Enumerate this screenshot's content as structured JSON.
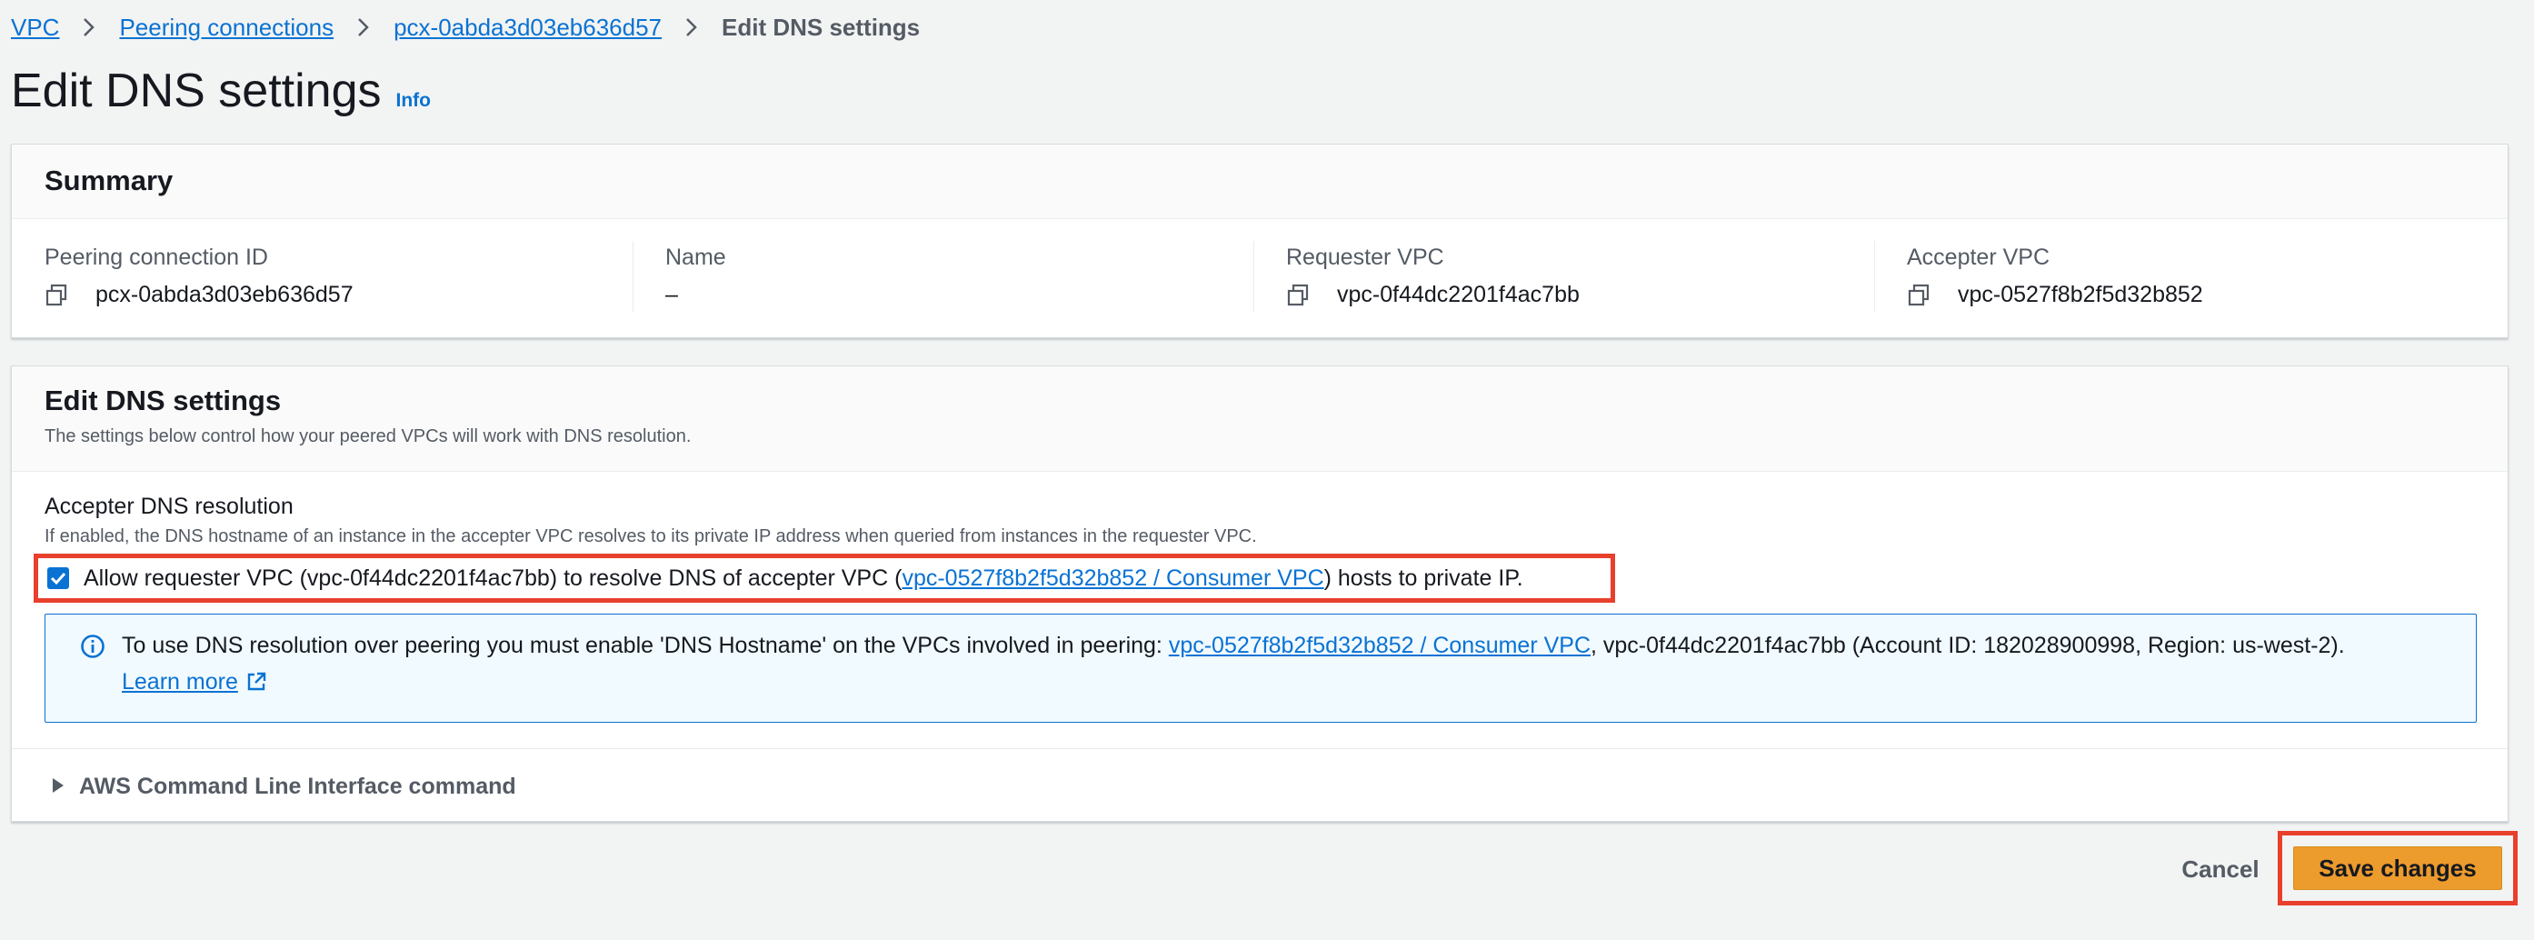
{
  "breadcrumb": {
    "items": [
      "VPC",
      "Peering connections",
      "pcx-0abda3d03eb636d57"
    ],
    "current": "Edit DNS settings"
  },
  "page": {
    "title": "Edit DNS settings",
    "info_label": "Info"
  },
  "summary": {
    "title": "Summary",
    "fields": [
      {
        "label": "Peering connection ID",
        "value": "pcx-0abda3d03eb636d57"
      },
      {
        "label": "Name",
        "value": "–"
      },
      {
        "label": "Requester VPC",
        "value": "vpc-0f44dc2201f4ac7bb"
      },
      {
        "label": "Accepter VPC",
        "value": "vpc-0527f8b2f5d32b852"
      }
    ]
  },
  "dns": {
    "title": "Edit DNS settings",
    "description": "The settings below control how your peered VPCs will work with DNS resolution.",
    "field_label": "Accepter DNS resolution",
    "field_description": "If enabled, the DNS hostname of an instance in the accepter VPC resolves to its private IP address when queried from instances in the requester VPC.",
    "checkbox_checked": true,
    "checkbox_prefix": "Allow requester VPC (vpc-0f44dc2201f4ac7bb) to resolve DNS of accepter VPC (",
    "checkbox_link": "vpc-0527f8b2f5d32b852 / Consumer VPC",
    "checkbox_suffix": ") hosts to private IP.",
    "alert": {
      "prefix": "To use DNS resolution over peering you must enable 'DNS Hostname' on the VPCs involved in peering: ",
      "link": "vpc-0527f8b2f5d32b852 / Consumer VPC",
      "suffix": ", vpc-0f44dc2201f4ac7bb (Account ID: 182028900998, Region: us-west-2).",
      "learn_more": "Learn more"
    },
    "cli_label": "AWS Command Line Interface command"
  },
  "actions": {
    "cancel": "Cancel",
    "save": "Save changes"
  },
  "colors": {
    "link": "#0972d3",
    "primary_button": "#ec9b2d",
    "highlight_box": "#e8402c"
  }
}
